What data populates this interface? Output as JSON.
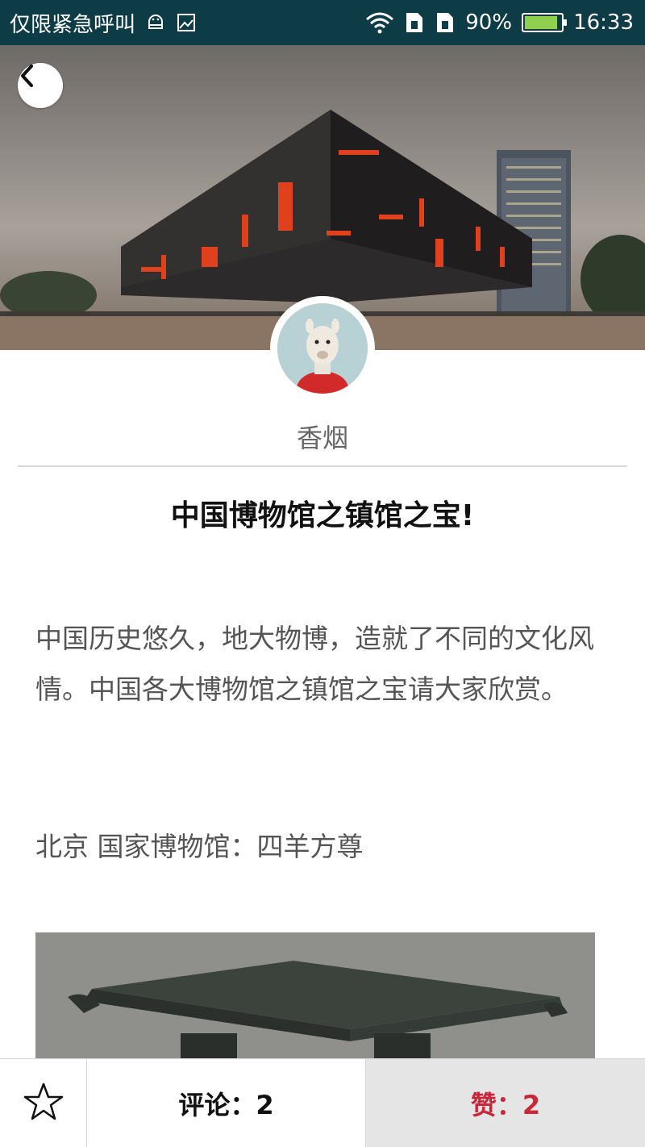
{
  "status_bar": {
    "carrier": "仅限紧急呼叫",
    "battery_percent": "90%",
    "time": "16:33",
    "icons": [
      "android-icon",
      "image-icon",
      "wifi-icon",
      "sim1-icon",
      "sim2-icon",
      "battery-icon"
    ]
  },
  "hero": {
    "image": "museum-building-photo",
    "back_icon": "chevron-left-icon"
  },
  "author": {
    "name": "香烟",
    "avatar": "alpaca-avatar"
  },
  "article": {
    "title": "中国博物馆之镇馆之宝!",
    "intro": "中国历史悠久，地大物博，造就了不同的文化风情。中国各大博物馆之镇馆之宝请大家欣赏。",
    "section_line": "北京 国家博物馆：四羊方尊",
    "image": "bronze-vessel-photo"
  },
  "bottom_bar": {
    "favorite_icon": "star-outline-icon",
    "comment_label": "评论：2",
    "like_label": "赞：2"
  },
  "colors": {
    "status_bar_bg": "#0d3c47",
    "like_text": "#c8273a",
    "like_bg": "#e5e5e5"
  }
}
